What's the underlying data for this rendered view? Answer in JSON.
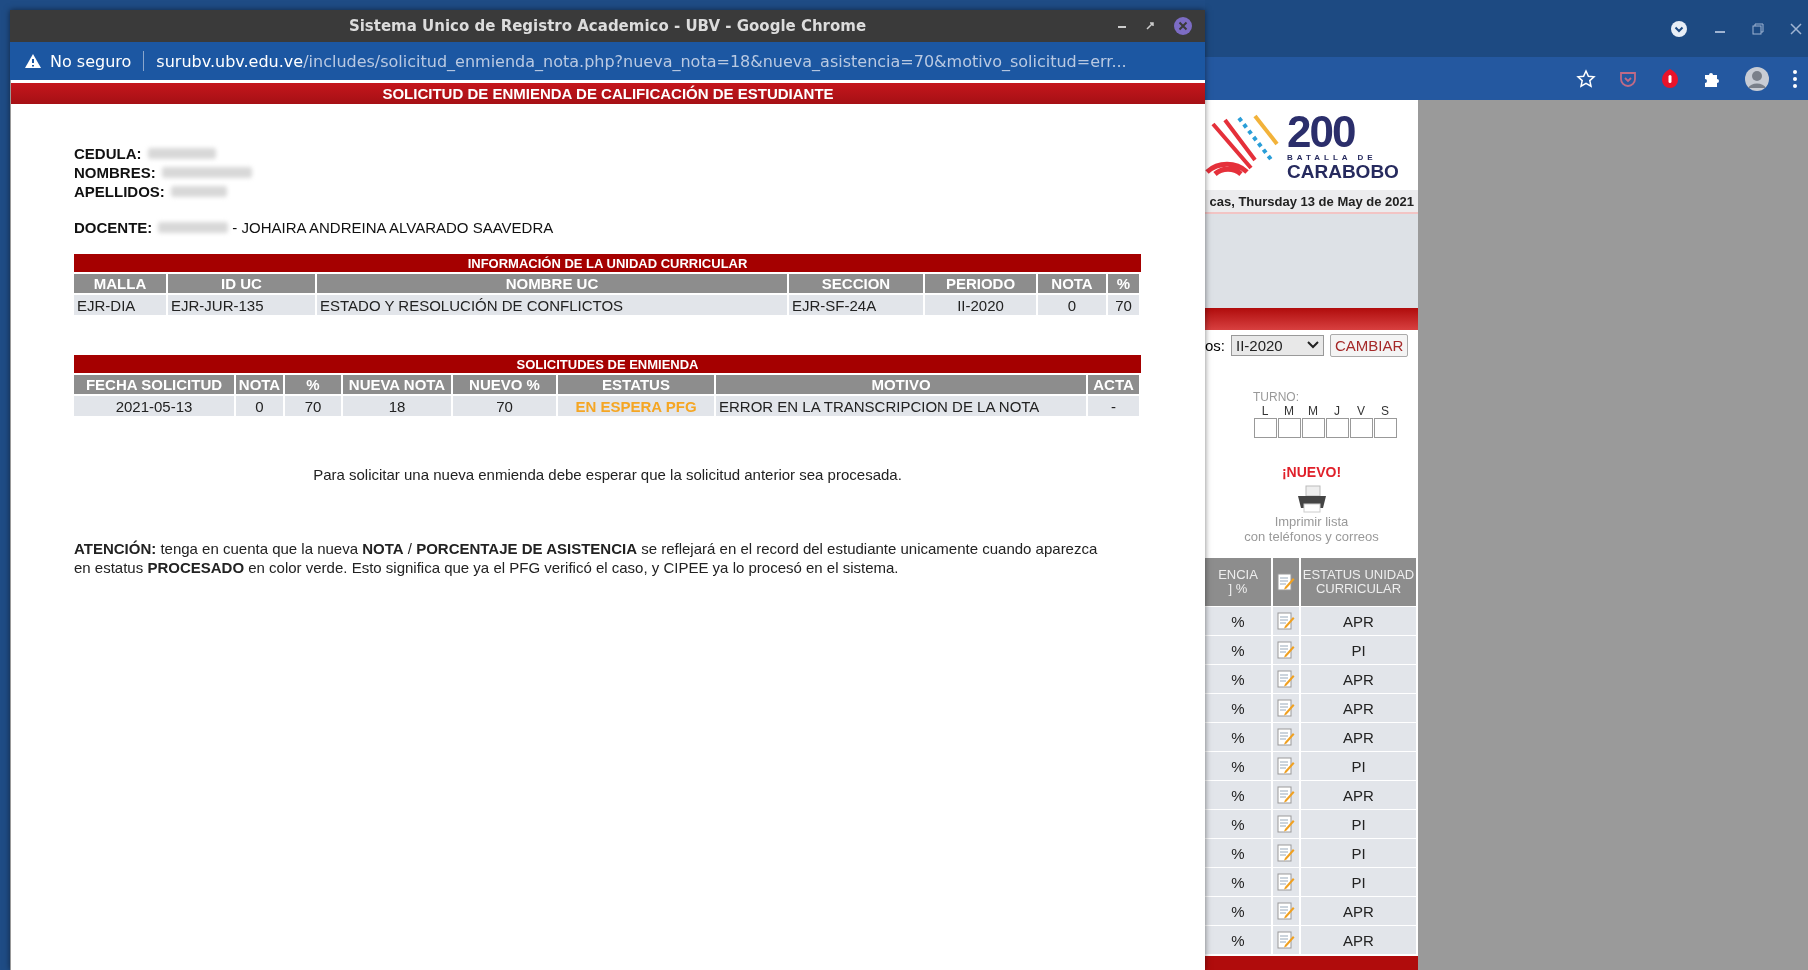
{
  "popup": {
    "title": "Sistema Unico de Registro Academico - UBV - Google Chrome",
    "security": "No seguro",
    "url_host": "surubv.ubv.edu.ve",
    "url_path": "/includes/solicitud_enmienda_nota.php?nueva_nota=18&nueva_asistencia=70&motivo_solicitud=err..."
  },
  "page_title": "SOLICITUD DE ENMIENDA DE CALIFICACIÓN DE ESTUDIANTE",
  "student": [
    {
      "label": "CEDULA:"
    },
    {
      "label": "NOMBRES:"
    },
    {
      "label": "APELLIDOS:"
    }
  ],
  "teacher": {
    "label": "DOCENTE:",
    "name": "- JOHAIRA ANDREINA ALVARADO SAAVEDRA"
  },
  "course_table": {
    "title": "INFORMACIÓN DE LA UNIDAD CURRICULAR",
    "columns": [
      {
        "label": "MALLA"
      },
      {
        "label": "ID UC"
      },
      {
        "label": "NOMBRE UC"
      },
      {
        "label": "SECCION"
      },
      {
        "label": "PERIODO"
      },
      {
        "label": "NOTA"
      },
      {
        "label": "%"
      }
    ],
    "rows": [
      [
        {
          "text": "EJR-DIA"
        },
        {
          "text": "EJR-JUR-135"
        },
        {
          "text": "ESTADO Y RESOLUCIÓN DE CONFLICTOS"
        },
        {
          "text": "EJR-SF-24A"
        },
        {
          "text": "II-2020"
        },
        {
          "text": "0"
        },
        {
          "text": "70"
        }
      ]
    ]
  },
  "requests_table": {
    "title": "SOLICITUDES DE ENMIENDA",
    "columns": [
      {
        "label": "FECHA SOLICITUD"
      },
      {
        "label": "NOTA"
      },
      {
        "label": "%"
      },
      {
        "label": "NUEVA NOTA"
      },
      {
        "label": "NUEVO %"
      },
      {
        "label": "ESTATUS"
      },
      {
        "label": "MOTIVO"
      },
      {
        "label": "ACTA"
      }
    ],
    "rows": [
      [
        {
          "text": "2021-05-13"
        },
        {
          "text": "0"
        },
        {
          "text": "70"
        },
        {
          "text": "18"
        },
        {
          "text": "70"
        },
        {
          "text": "EN ESPERA PFG",
          "color": "#f5a623"
        },
        {
          "text": "ERROR EN LA TRANSCRIPCION DE LA NOTA"
        },
        {
          "text": "-"
        }
      ]
    ]
  },
  "notice": "Para solicitar una nueva enmienda debe esperar que la solicitud anterior sea procesada.",
  "attention": "**ATENCIÓN:** tenga en cuenta que la nueva **NOTA** / **PORCENTAJE DE ASISTENCIA** se reflejará en el record del estudiante unicamente cuando aparezca en estatus **PROCESADO** en color verde. Esto significa que ya el PFG verificó el caso, y CIPEE ya lo procesó en el sistema.",
  "background_page": {
    "logo": {
      "number": "200",
      "line1": "BATALLA DE",
      "line2": "CARABOBO"
    },
    "date": "cas, Thursday 13 de May de 2021",
    "period_label": "os:",
    "period_value": "II-2020",
    "change_button": "CAMBIAR",
    "turno_label": "TURNO:",
    "days": [
      {
        "label": "L",
        "checked": false
      },
      {
        "label": "M",
        "checked": false
      },
      {
        "label": "M",
        "checked": false
      },
      {
        "label": "J",
        "checked": false
      },
      {
        "label": "V",
        "checked": false
      },
      {
        "label": "S",
        "checked": false
      }
    ],
    "new_badge": "¡NUEVO!",
    "print_link": [
      "Imprimir lista",
      "con teléfonos y correos"
    ],
    "col1_header": [
      "ENCIA",
      "] %"
    ],
    "status_header": "ESTATUS UNIDAD CURRICULAR",
    "rows": [
      {
        "pct": "%",
        "status": "APR"
      },
      {
        "pct": "%",
        "status": "PI"
      },
      {
        "pct": "%",
        "status": "APR"
      },
      {
        "pct": "%",
        "status": "APR"
      },
      {
        "pct": "%",
        "status": "APR"
      },
      {
        "pct": "%",
        "status": "PI"
      },
      {
        "pct": "%",
        "status": "APR"
      },
      {
        "pct": "%",
        "status": "PI"
      },
      {
        "pct": "%",
        "status": "PI"
      },
      {
        "pct": "%",
        "status": "PI"
      },
      {
        "pct": "%",
        "status": "APR"
      },
      {
        "pct": "%",
        "status": "APR"
      }
    ]
  }
}
